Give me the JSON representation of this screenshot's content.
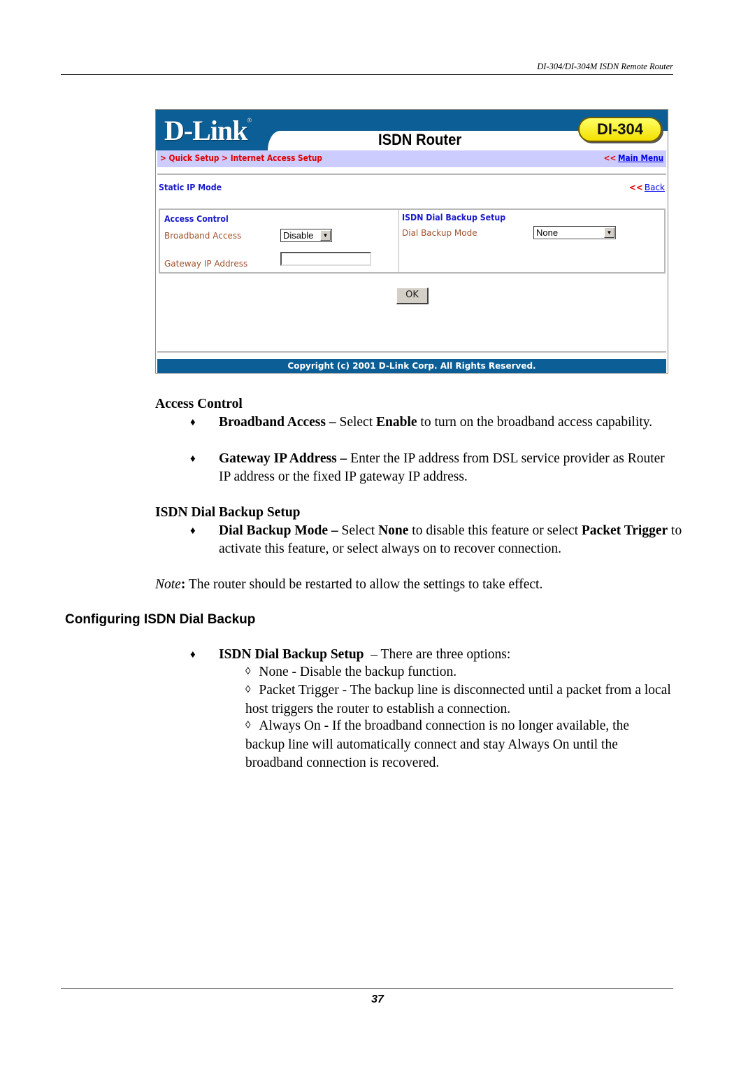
{
  "running_header": "DI-304/DI-304M ISDN Remote Router",
  "screenshot": {
    "logo": "D-Link",
    "logo_mark": "®",
    "title": "ISDN Router",
    "model_badge": "DI-304",
    "breadcrumb": "> Quick Setup > Internet Access Setup",
    "main_menu_chevron": "<<",
    "main_menu_label": "Main Menu",
    "mode_title": "Static IP Mode",
    "back_chevron": "<<",
    "back_label": "Back",
    "access_control": {
      "title": "Access Control",
      "broadband_label": "Broadband Access",
      "broadband_value": "Disable",
      "gateway_label": "Gateway IP Address",
      "gateway_value": ""
    },
    "dial_backup": {
      "title": "ISDN Dial Backup Setup",
      "mode_label": "Dial Backup Mode",
      "mode_value": "None"
    },
    "ok_label": "OK",
    "copyright": "Copyright (c) 2001 D-Link Corp. All Rights Reserved.",
    "arrow_glyph": "▼"
  },
  "doc": {
    "access_control_heading": "Access Control",
    "bullet_glyph": "♦",
    "b1_bold": "Broadband Access –",
    "b1_t1": " Select ",
    "b1_bold2": "Enable",
    "b1_t2": " to turn on the broadband access capability.",
    "b2_bold": "Gateway IP Address –",
    "b2_t1": " Enter the IP address from DSL service provider as Router IP address or the fixed IP gateway IP address.",
    "dial_heading": "ISDN Dial Backup Setup",
    "b3_bold": "Dial Backup Mode –",
    "b3_t1": " Select ",
    "b3_bold2": "None",
    "b3_t2": " to disable this feature or select ",
    "b3_bold3": "Packet Trigger",
    "b3_t3": " to activate this feature, or select always on to recover connection.",
    "note_label": "Note",
    "note_colon": ":",
    "note_text": " The router should be restarted to allow the settings to take effect.",
    "section_heading": "Configuring ISDN Dial Backup",
    "b4_bold": "ISDN Dial Backup Setup",
    "b4_t1": "  – There are three options:",
    "sub_glyph": "◊",
    "opt1": "None - Disable the backup function.",
    "opt2": "Packet Trigger - The backup line is disconnected until a packet from a local host triggers the router to establish a connection.",
    "opt3": "Always On - If the broadband connection is no longer available, the backup line will automatically connect and stay Always On until the broadband connection is recovered."
  },
  "page_number": "37"
}
